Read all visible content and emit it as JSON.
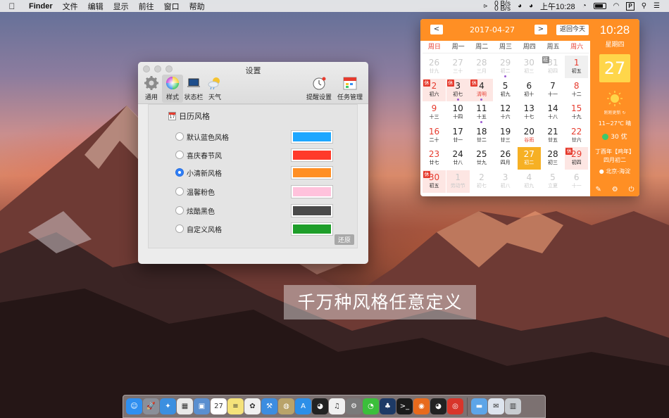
{
  "menubar": {
    "app_name": "Finder",
    "menus": [
      "文件",
      "编辑",
      "显示",
      "前往",
      "窗口",
      "帮助"
    ],
    "net_up": "0 B/s",
    "net_down": "0 B/s",
    "clock": "上午10:28",
    "p_box": "P"
  },
  "settings": {
    "title": "设置",
    "toolbar": [
      {
        "label": "通用",
        "icon": "gear-icon"
      },
      {
        "label": "样式",
        "icon": "color-wheel-icon"
      },
      {
        "label": "状态栏",
        "icon": "laptop-icon"
      },
      {
        "label": "天气",
        "icon": "weather-icon"
      }
    ],
    "toolbar_right": [
      {
        "label": "提醒设置",
        "icon": "alarm-clock-icon"
      },
      {
        "label": "任务管理",
        "icon": "task-calendar-icon"
      }
    ],
    "section_title": "日历风格",
    "section_icon_text": "17",
    "styles": [
      {
        "label": "默认蓝色风格",
        "color": "#1ea7ff",
        "selected": false
      },
      {
        "label": "喜庆春节风",
        "color": "#ff3a2a",
        "selected": false
      },
      {
        "label": "小清新风格",
        "color": "#ff8f24",
        "selected": true
      },
      {
        "label": "温馨粉色",
        "color": "#ffc2dc",
        "selected": false
      },
      {
        "label": "炫酷黑色",
        "color": "#4a4a4a",
        "selected": false
      },
      {
        "label": "自定义风格",
        "color": "#1e9e2a",
        "selected": false
      }
    ],
    "restore_label": "还原"
  },
  "calendar": {
    "accent": "#ff8f24",
    "prev": "<",
    "next": ">",
    "month_label": "2017-04-27",
    "today_button": "返回今天",
    "weekdays": [
      "周日",
      "周一",
      "周二",
      "周三",
      "周四",
      "周五",
      "周六"
    ],
    "rows": [
      [
        {
          "d": "26",
          "l": "廿九",
          "other": true
        },
        {
          "d": "27",
          "l": "三十",
          "other": true
        },
        {
          "d": "28",
          "l": "三月",
          "other": true
        },
        {
          "d": "29",
          "l": "初二",
          "other": true,
          "dot": true
        },
        {
          "d": "30",
          "l": "初三",
          "other": true
        },
        {
          "d": "31",
          "l": "初四",
          "other": true,
          "tag": "班"
        },
        {
          "d": "1",
          "l": "初五",
          "red": true,
          "work": true
        }
      ],
      [
        {
          "d": "2",
          "l": "初六",
          "red": true,
          "hol": true,
          "tag": "休"
        },
        {
          "d": "3",
          "l": "初七",
          "hol": true,
          "tag": "休",
          "dot": true
        },
        {
          "d": "4",
          "l": "清明",
          "hol": true,
          "tag": "休",
          "hl": true,
          "dot": true
        },
        {
          "d": "5",
          "l": "初九"
        },
        {
          "d": "6",
          "l": "初十"
        },
        {
          "d": "7",
          "l": "十一"
        },
        {
          "d": "8",
          "l": "十二",
          "red": true
        }
      ],
      [
        {
          "d": "9",
          "l": "十三",
          "red": true
        },
        {
          "d": "10",
          "l": "十四"
        },
        {
          "d": "11",
          "l": "十五",
          "dot": true
        },
        {
          "d": "12",
          "l": "十六"
        },
        {
          "d": "13",
          "l": "十七"
        },
        {
          "d": "14",
          "l": "十八"
        },
        {
          "d": "15",
          "l": "十九",
          "red": true
        }
      ],
      [
        {
          "d": "16",
          "l": "二十",
          "red": true
        },
        {
          "d": "17",
          "l": "廿一"
        },
        {
          "d": "18",
          "l": "廿二"
        },
        {
          "d": "19",
          "l": "廿三"
        },
        {
          "d": "20",
          "l": "谷雨",
          "hl": true
        },
        {
          "d": "21",
          "l": "廿五"
        },
        {
          "d": "22",
          "l": "廿六",
          "red": true
        }
      ],
      [
        {
          "d": "23",
          "l": "廿七",
          "red": true
        },
        {
          "d": "24",
          "l": "廿八"
        },
        {
          "d": "25",
          "l": "廿九"
        },
        {
          "d": "26",
          "l": "四月"
        },
        {
          "d": "27",
          "l": "初二",
          "sel": true
        },
        {
          "d": "28",
          "l": "初三"
        },
        {
          "d": "29",
          "l": "初四",
          "red": true,
          "hol": true,
          "tag": "休"
        }
      ],
      [
        {
          "d": "30",
          "l": "初五",
          "red": true,
          "hol": true,
          "tag": "休"
        },
        {
          "d": "1",
          "l": "劳动节",
          "other": true,
          "hol": true
        },
        {
          "d": "2",
          "l": "初七",
          "other": true
        },
        {
          "d": "3",
          "l": "初八",
          "other": true
        },
        {
          "d": "4",
          "l": "初九",
          "other": true
        },
        {
          "d": "5",
          "l": "立夏",
          "other": true
        },
        {
          "d": "6",
          "l": "十一",
          "other": true
        }
      ]
    ],
    "side": {
      "time": "10:28",
      "weekday": "星期四",
      "day": "27",
      "update_text": "刚刚更新",
      "temperature": "11~27℃ 晴",
      "aqi": "30 优",
      "lunar_year": "丁酉年【鸡年】",
      "lunar_date": "四月初二",
      "location": "北京-海淀"
    }
  },
  "banner": "千万种风格任意定义",
  "dock": [
    {
      "name": "finder",
      "color": "#2f8ff0",
      "glyph": "☺"
    },
    {
      "name": "launchpad",
      "color": "#8a8f99",
      "glyph": "🚀"
    },
    {
      "name": "safari",
      "color": "#3b8fe0",
      "glyph": "✦"
    },
    {
      "name": "calculator",
      "color": "#e9e9e9",
      "glyph": "▦"
    },
    {
      "name": "preview",
      "color": "#5a8fd0",
      "glyph": "▣"
    },
    {
      "name": "calendar",
      "color": "#ffffff",
      "glyph": "27"
    },
    {
      "name": "notes",
      "color": "#f5e27a",
      "glyph": "≡"
    },
    {
      "name": "photos",
      "color": "#f0f0f0",
      "glyph": "✿"
    },
    {
      "name": "xcode",
      "color": "#3c8de0",
      "glyph": "⚒"
    },
    {
      "name": "disk-utility",
      "color": "#b9a36a",
      "glyph": "◍"
    },
    {
      "name": "app-store",
      "color": "#2c8fe8",
      "glyph": "A"
    },
    {
      "name": "qq",
      "color": "#222222",
      "glyph": "◕"
    },
    {
      "name": "itunes",
      "color": "#f0f0f0",
      "glyph": "♫"
    },
    {
      "name": "system-preferences",
      "color": "#7a7a7a",
      "glyph": "⚙"
    },
    {
      "name": "wechat",
      "color": "#3bbf3b",
      "glyph": "◔"
    },
    {
      "name": "sourcetree",
      "color": "#1d3a66",
      "glyph": "♣"
    },
    {
      "name": "terminal",
      "color": "#1b1b1b",
      "glyph": ">_"
    },
    {
      "name": "firefox",
      "color": "#e86a1c",
      "glyph": "◉"
    },
    {
      "name": "qq-2",
      "color": "#222222",
      "glyph": "◕"
    },
    {
      "name": "netease-music",
      "color": "#d8352a",
      "glyph": "◎"
    },
    {
      "name": "folder",
      "color": "#5da5e8",
      "glyph": "▬"
    },
    {
      "name": "mail",
      "color": "#dde4ee",
      "glyph": "✉"
    },
    {
      "name": "trash",
      "color": "#c8ccd1",
      "glyph": "▥"
    }
  ]
}
